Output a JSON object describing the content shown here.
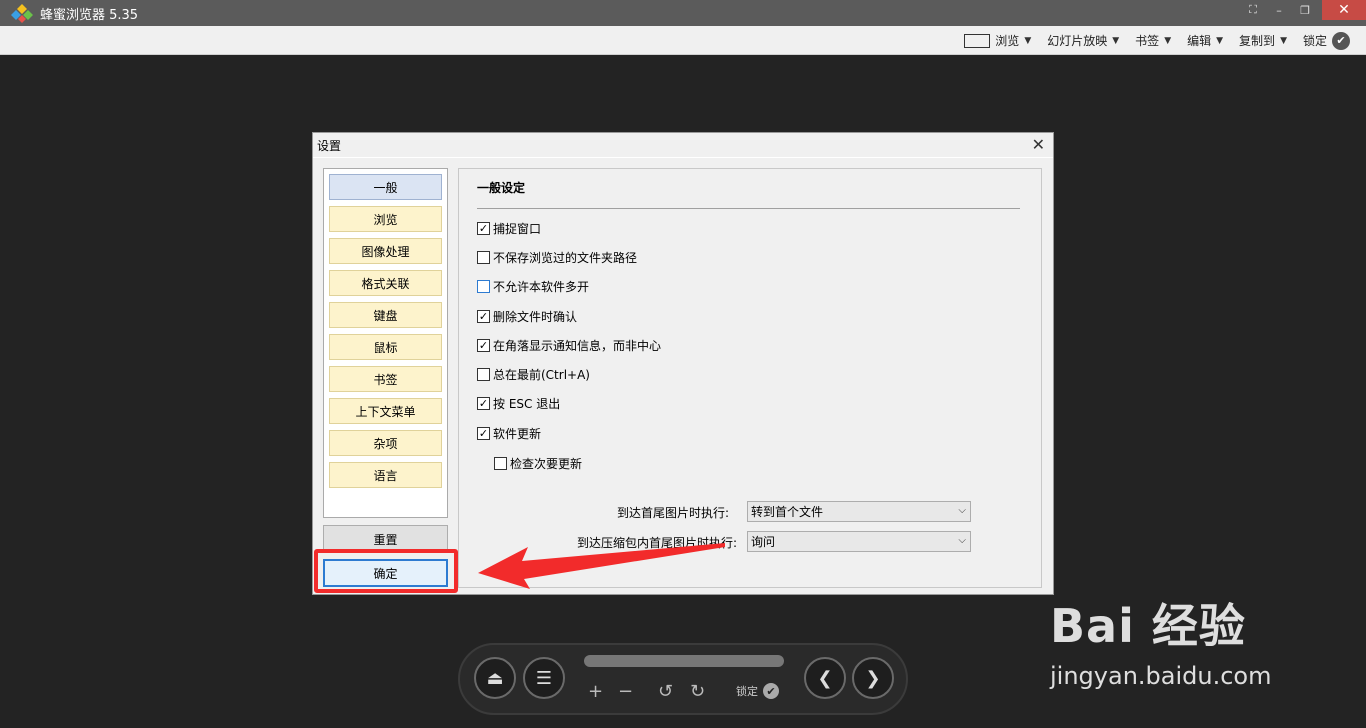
{
  "window": {
    "title": "蜂蜜浏览器 5.35",
    "close": "✕",
    "minimize": "–",
    "restore": "❐",
    "fullscreen": "⛶"
  },
  "toolbar": {
    "items": [
      {
        "label": "浏览",
        "icon": "browse-frame-icon"
      },
      {
        "label": "幻灯片放映"
      },
      {
        "label": "书签"
      },
      {
        "label": "编辑"
      },
      {
        "label": "复制到"
      },
      {
        "label": "锁定",
        "icon": "check-circle-icon"
      }
    ],
    "arrow": "▼",
    "check": "✔"
  },
  "dialog": {
    "title": "设置",
    "close": "✕",
    "nav": [
      "一般",
      "浏览",
      "图像处理",
      "格式关联",
      "键盘",
      "鼠标",
      "书签",
      "上下文菜单",
      "杂项",
      "语言"
    ],
    "active_nav": "一般",
    "reset_label": "重置",
    "ok_label": "确定",
    "section_title": "一般设定",
    "options": [
      {
        "label": "捕捉窗口",
        "checked": true
      },
      {
        "label": "不保存浏览过的文件夹路径",
        "checked": false
      },
      {
        "label": "不允许本软件多开",
        "checked": false
      },
      {
        "label": "删除文件时确认",
        "checked": true
      },
      {
        "label": "在角落显示通知信息，而非中心",
        "checked": true
      },
      {
        "label": "总在最前(Ctrl+A)",
        "checked": false
      },
      {
        "label": "按 ESC 退出",
        "checked": true
      },
      {
        "label": "软件更新",
        "checked": true
      },
      {
        "label": "检查次要更新",
        "checked": false
      }
    ],
    "check_mark": "✓",
    "select1": {
      "label": "到达首尾图片时执行:",
      "value": "转到首个文件"
    },
    "select2": {
      "label": "到达压缩包内首尾图片时执行:",
      "value": "询问"
    },
    "caret": "⌵"
  },
  "controls": {
    "eject": "⏏",
    "menu": "☰",
    "zoom_in": "+",
    "zoom_out": "−",
    "rotate_left": "↺",
    "rotate_right": "↻",
    "lock_label": "锁定",
    "prev": "❮",
    "next": "❯"
  },
  "watermark": {
    "brand": "Bai 经验",
    "url": "jingyan.baidu.com"
  },
  "colors": {
    "highlight_red": "#f22b2b",
    "nav_yellow": "#fdf3cc",
    "nav_active": "#dbe4f3"
  }
}
